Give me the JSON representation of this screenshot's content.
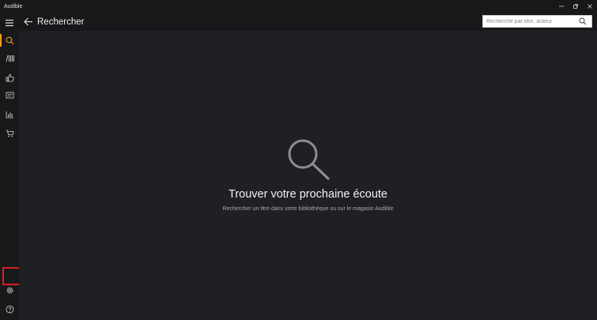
{
  "window": {
    "title": "Audible",
    "controls": [
      "minimize-icon",
      "restore-icon",
      "close-icon"
    ]
  },
  "sidebar": {
    "items": [
      {
        "name": "menu",
        "icon": "hamburger-icon",
        "active": false
      },
      {
        "name": "search",
        "icon": "search-icon",
        "active": true
      },
      {
        "name": "library",
        "icon": "library-icon",
        "active": false
      },
      {
        "name": "recommendations",
        "icon": "thumbs-up-icon",
        "active": false
      },
      {
        "name": "messages",
        "icon": "message-icon",
        "active": false
      },
      {
        "name": "stats",
        "icon": "stats-icon",
        "active": false
      },
      {
        "name": "store",
        "icon": "cart-icon",
        "active": false
      }
    ],
    "bottom_items": [
      {
        "name": "settings",
        "icon": "gear-icon",
        "highlighted": true
      },
      {
        "name": "help",
        "icon": "help-icon"
      }
    ]
  },
  "header": {
    "title": "Rechercher",
    "back_icon": "back-arrow-icon"
  },
  "search": {
    "placeholder": "Recherche par titre, auteur",
    "value": ""
  },
  "empty_state": {
    "icon": "magnifier-icon",
    "title": "Trouver votre prochaine écoute",
    "subtitle": "Rechercher un titre dans votre bibliothèque ou sur le magasin Audible"
  },
  "colors": {
    "accent": "#f7991c",
    "highlight": "#d91f26",
    "background": "#1f2023",
    "sidebar": "#18191b",
    "text": "#f2f2f2",
    "subtext": "#a9a9a9"
  }
}
